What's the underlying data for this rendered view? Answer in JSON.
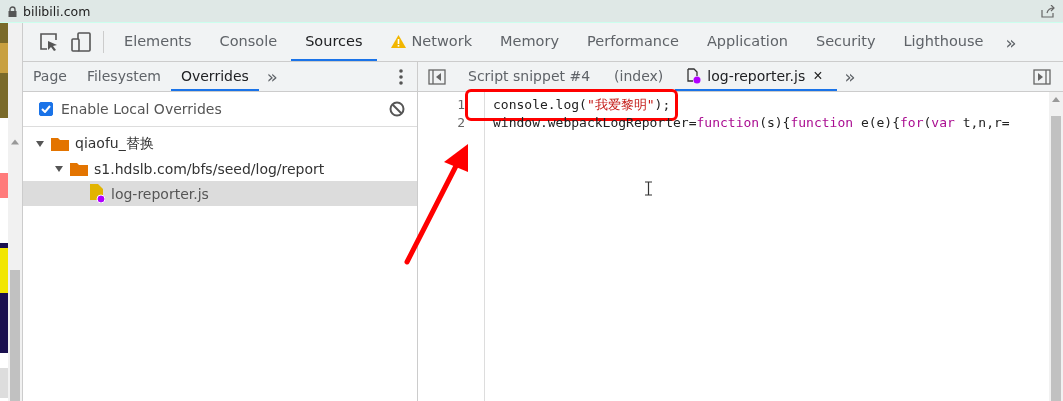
{
  "address_bar": {
    "url": "bilibili.com"
  },
  "main_tabs": [
    {
      "label": "Elements",
      "selected": false,
      "warning": false
    },
    {
      "label": "Console",
      "selected": false,
      "warning": false
    },
    {
      "label": "Sources",
      "selected": true,
      "warning": false
    },
    {
      "label": "Network",
      "selected": false,
      "warning": true
    },
    {
      "label": "Memory",
      "selected": false,
      "warning": false
    },
    {
      "label": "Performance",
      "selected": false,
      "warning": false
    },
    {
      "label": "Application",
      "selected": false,
      "warning": false
    },
    {
      "label": "Security",
      "selected": false,
      "warning": false
    },
    {
      "label": "Lighthouse",
      "selected": false,
      "warning": false
    }
  ],
  "more_tabs": "»",
  "navigator_tabs": [
    {
      "label": "Page",
      "selected": false
    },
    {
      "label": "Filesystem",
      "selected": false
    },
    {
      "label": "Overrides",
      "selected": true
    }
  ],
  "navigator_more": "»",
  "enable_overrides": {
    "label": "Enable Local Overrides",
    "checked": true
  },
  "tree": [
    {
      "kind": "folder",
      "label": "qiaofu_替换",
      "expanded": true,
      "selected": false,
      "children": [
        {
          "kind": "folder",
          "label": "s1.hdslb.com/bfs/seed/log/report",
          "expanded": true,
          "selected": false,
          "children": [
            {
              "kind": "file",
              "label": "log-reporter.js",
              "selected": true
            }
          ]
        }
      ]
    }
  ],
  "editor_tabs": [
    {
      "label": "Script snippet #4",
      "selected": false,
      "modified": false
    },
    {
      "label": "(index)",
      "selected": false,
      "modified": false
    },
    {
      "label": "log-reporter.js",
      "selected": true,
      "modified": true
    }
  ],
  "editor_close": "×",
  "editor_more": "»",
  "code_lines": [
    {
      "number": "1",
      "highlighted": true,
      "tokens": [
        {
          "kind": "plain",
          "text": "console.log("
        },
        {
          "kind": "string",
          "text": "\"我爱黎明\""
        },
        {
          "kind": "plain",
          "text": ");"
        }
      ]
    },
    {
      "number": "2",
      "highlighted": false,
      "tokens": [
        {
          "kind": "plain",
          "text": "window.webpackLogReporter="
        },
        {
          "kind": "keyword",
          "text": "function"
        },
        {
          "kind": "plain",
          "text": "(s){"
        },
        {
          "kind": "keyword",
          "text": "function"
        },
        {
          "kind": "plain",
          "text": " e(e){"
        },
        {
          "kind": "keyword",
          "text": "for"
        },
        {
          "kind": "plain",
          "text": "("
        },
        {
          "kind": "keyword",
          "text": "var"
        },
        {
          "kind": "plain",
          "text": " t,n,r="
        }
      ]
    }
  ]
}
